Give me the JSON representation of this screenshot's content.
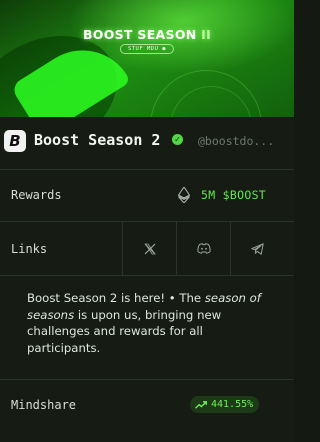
{
  "banner": {
    "title_main": "BOOST SEASON ",
    "title_accent": "II",
    "pill_text": "STUF MDU ●"
  },
  "profile": {
    "logo_letter": "B",
    "name": "Boost Season 2",
    "verified_mark": "✓",
    "handle": "@boostdo..."
  },
  "rewards": {
    "label": "Rewards",
    "value": "5M $BOOST"
  },
  "links": {
    "label": "Links"
  },
  "description": {
    "part1": "Boost Season 2 is here! • The ",
    "emphasis": "season of seasons",
    "part2": " is upon us, bringing new challenges and rewards for all participants."
  },
  "mindshare": {
    "label": "Mindshare",
    "value": "441.55%"
  },
  "colors": {
    "accent_green": "#5ee84a",
    "background": "#161c14"
  }
}
